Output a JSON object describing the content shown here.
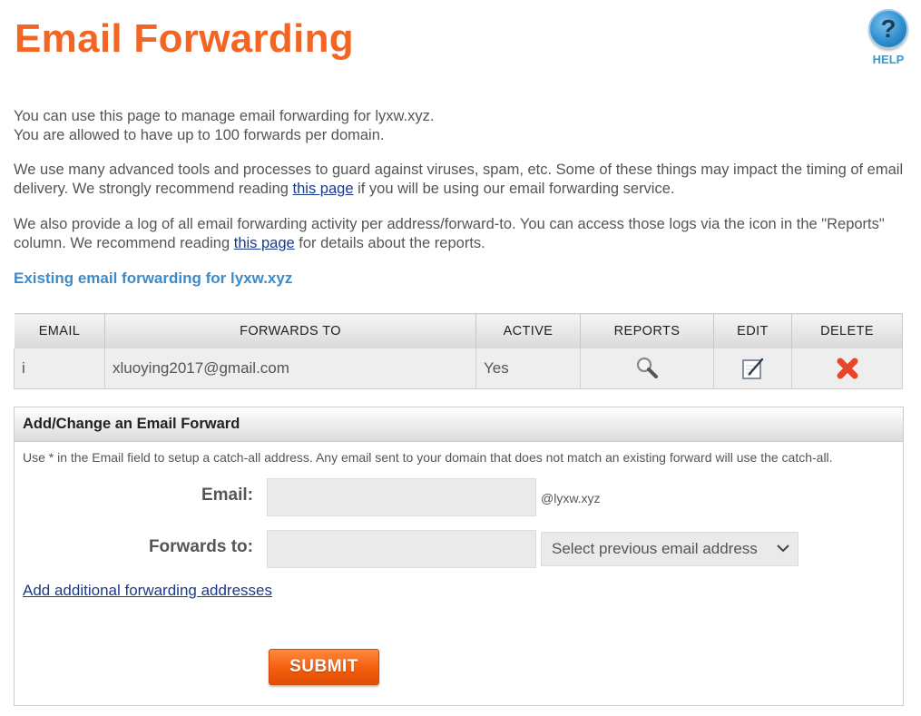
{
  "page": {
    "title": "Email Forwarding",
    "help_label": "HELP"
  },
  "intro": {
    "p1_line1": "You can use this page to manage email forwarding for lyxw.xyz.",
    "p1_line2": "You are allowed to have up to 100 forwards per domain.",
    "p2_before": "We use many advanced tools and processes to guard against viruses, spam, etc. Some of these things may impact the timing of email delivery. We strongly recommend reading ",
    "p2_link": "this page",
    "p2_after": " if you will be using our email forwarding service.",
    "p3_before": "We also provide a log of all email forwarding activity per address/forward-to. You can access those logs via the icon in the \"Reports\" column. We recommend reading ",
    "p3_link": "this page",
    "p3_after": " for details about the reports."
  },
  "existing": {
    "heading": "Existing email forwarding for lyxw.xyz",
    "columns": {
      "email": "EMAIL",
      "forwards_to": "FORWARDS TO",
      "active": "ACTIVE",
      "reports": "REPORTS",
      "edit": "EDIT",
      "delete": "DELETE"
    },
    "rows": [
      {
        "email": "i",
        "forwards_to": "xluoying2017@gmail.com",
        "active": "Yes",
        "reports_icon": "magnifier-icon",
        "edit_icon": "edit-icon",
        "delete_icon": "delete-x-icon"
      }
    ]
  },
  "form": {
    "heading": "Add/Change an Email Forward",
    "note": "Use * in the Email field to setup a catch-all address. Any email sent to your domain that does not match an existing forward will use the catch-all.",
    "email_label": "Email:",
    "email_value": "",
    "domain_suffix": "@lyxw.xyz",
    "forwards_label": "Forwards to:",
    "forwards_value": "",
    "select_placeholder": "Select previous email address",
    "add_link": "Add additional forwarding addresses",
    "submit_label": "SUBMIT"
  },
  "colors": {
    "title_orange": "#f26522",
    "heading_blue": "#3d8ac9",
    "link_blue": "#1a3a8a",
    "delete_red": "#e8452c",
    "submit_orange": "#f45d0e"
  }
}
